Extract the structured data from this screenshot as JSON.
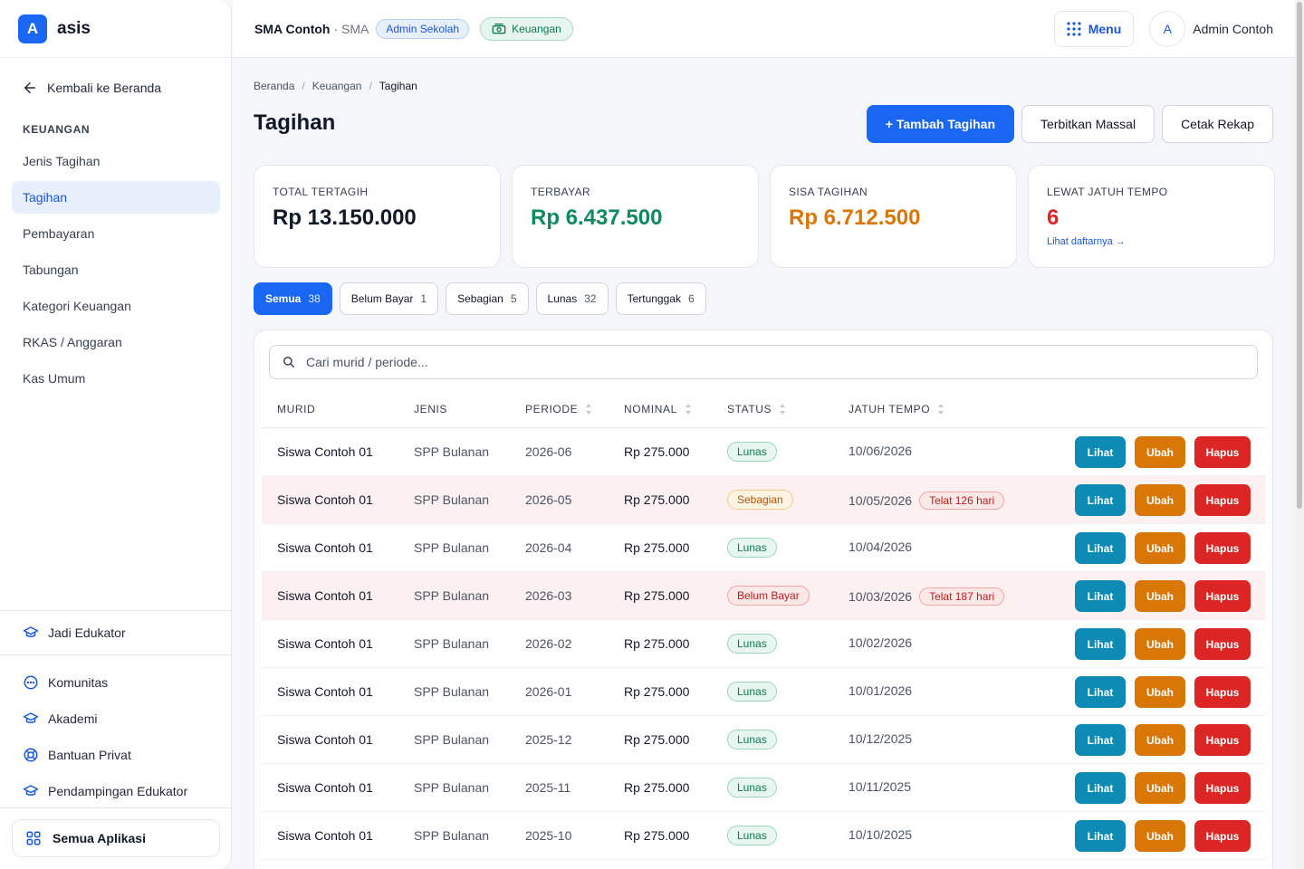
{
  "brand": {
    "logo_letter": "A",
    "name": "asis"
  },
  "sidebar": {
    "back_label": "Kembali ke Beranda",
    "section_title": "KEUANGAN",
    "items": [
      {
        "label": "Jenis Tagihan"
      },
      {
        "label": "Tagihan",
        "active": true
      },
      {
        "label": "Pembayaran"
      },
      {
        "label": "Tabungan"
      },
      {
        "label": "Kategori Keuangan"
      },
      {
        "label": "RKAS / Anggaran"
      },
      {
        "label": "Kas Umum"
      }
    ],
    "educator_link": "Jadi Edukator",
    "links": [
      {
        "label": "Komunitas",
        "icon": "chat-icon"
      },
      {
        "label": "Akademi",
        "icon": "graduation-cap-icon"
      },
      {
        "label": "Bantuan Privat",
        "icon": "lifebuoy-icon"
      },
      {
        "label": "Pendampingan Edukator",
        "icon": "graduation-cap-icon"
      }
    ],
    "all_apps_label": "Semua Aplikasi"
  },
  "topbar": {
    "school_name": "SMA Contoh",
    "school_type": "· SMA",
    "role_badge": "Admin Sekolah",
    "module_badge": "Keuangan",
    "menu_label": "Menu",
    "avatar_letter": "A",
    "user_name": "Admin Contoh"
  },
  "breadcrumb": [
    "Beranda",
    "Keuangan",
    "Tagihan"
  ],
  "page": {
    "title": "Tagihan",
    "actions": {
      "add": "+ Tambah Tagihan",
      "bulk": "Terbitkan Massal",
      "print": "Cetak Rekap"
    }
  },
  "stats": [
    {
      "label": "TOTAL TERTAGIH",
      "value": "Rp 13.150.000",
      "color": "#111827"
    },
    {
      "label": "TERBAYAR",
      "value": "Rp 6.437.500",
      "color": "#0f8a5f"
    },
    {
      "label": "SISA TAGIHAN",
      "value": "Rp 6.712.500",
      "color": "#d97706"
    },
    {
      "label": "LEWAT JATUH TEMPO",
      "value": "6",
      "color": "#dc2626",
      "link": "Lihat daftarnya →"
    }
  ],
  "filters": [
    {
      "label": "Semua",
      "count": "38",
      "active": true
    },
    {
      "label": "Belum Bayar",
      "count": "1"
    },
    {
      "label": "Sebagian",
      "count": "5"
    },
    {
      "label": "Lunas",
      "count": "32"
    },
    {
      "label": "Tertunggak",
      "count": "6"
    }
  ],
  "search": {
    "placeholder": "Cari murid / periode..."
  },
  "table": {
    "columns": [
      "MURID",
      "JENIS",
      "PERIODE",
      "NOMINAL",
      "STATUS",
      "JATUH TEMPO"
    ],
    "action_labels": {
      "view": "Lihat",
      "edit": "Ubah",
      "delete": "Hapus"
    },
    "rows": [
      {
        "murid": "Siswa Contoh 01",
        "jenis": "SPP Bulanan",
        "periode": "2026-06",
        "nominal": "Rp 275.000",
        "status": "Lunas",
        "status_type": "lunas",
        "due": "10/06/2026",
        "late": ""
      },
      {
        "murid": "Siswa Contoh 01",
        "jenis": "SPP Bulanan",
        "periode": "2026-05",
        "nominal": "Rp 275.000",
        "status": "Sebagian",
        "status_type": "sebagian",
        "due": "10/05/2026",
        "late": "Telat 126 hari"
      },
      {
        "murid": "Siswa Contoh 01",
        "jenis": "SPP Bulanan",
        "periode": "2026-04",
        "nominal": "Rp 275.000",
        "status": "Lunas",
        "status_type": "lunas",
        "due": "10/04/2026",
        "late": ""
      },
      {
        "murid": "Siswa Contoh 01",
        "jenis": "SPP Bulanan",
        "periode": "2026-03",
        "nominal": "Rp 275.000",
        "status": "Belum Bayar",
        "status_type": "belum",
        "due": "10/03/2026",
        "late": "Telat 187 hari"
      },
      {
        "murid": "Siswa Contoh 01",
        "jenis": "SPP Bulanan",
        "periode": "2026-02",
        "nominal": "Rp 275.000",
        "status": "Lunas",
        "status_type": "lunas",
        "due": "10/02/2026",
        "late": ""
      },
      {
        "murid": "Siswa Contoh 01",
        "jenis": "SPP Bulanan",
        "periode": "2026-01",
        "nominal": "Rp 275.000",
        "status": "Lunas",
        "status_type": "lunas",
        "due": "10/01/2026",
        "late": ""
      },
      {
        "murid": "Siswa Contoh 01",
        "jenis": "SPP Bulanan",
        "periode": "2025-12",
        "nominal": "Rp 275.000",
        "status": "Lunas",
        "status_type": "lunas",
        "due": "10/12/2025",
        "late": ""
      },
      {
        "murid": "Siswa Contoh 01",
        "jenis": "SPP Bulanan",
        "periode": "2025-11",
        "nominal": "Rp 275.000",
        "status": "Lunas",
        "status_type": "lunas",
        "due": "10/11/2025",
        "late": ""
      },
      {
        "murid": "Siswa Contoh 01",
        "jenis": "SPP Bulanan",
        "periode": "2025-10",
        "nominal": "Rp 275.000",
        "status": "Lunas",
        "status_type": "lunas",
        "due": "10/10/2025",
        "late": ""
      }
    ]
  }
}
